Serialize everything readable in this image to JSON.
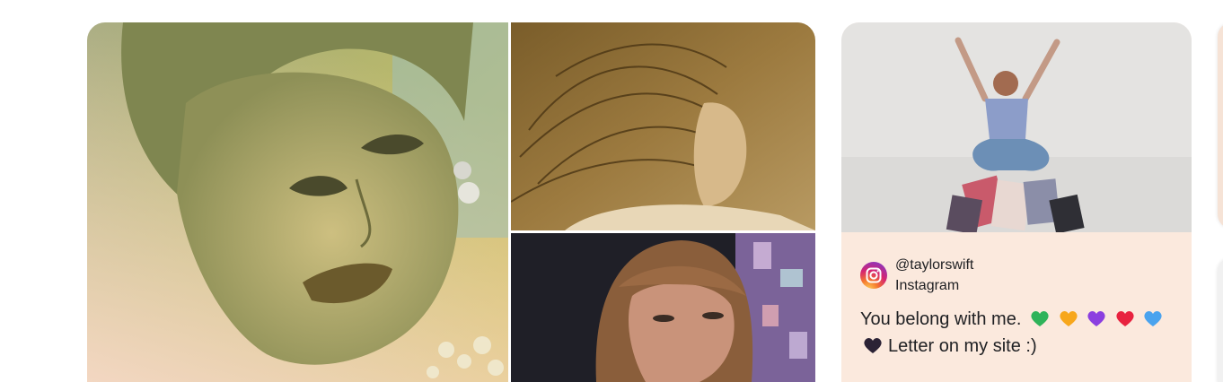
{
  "collage": {
    "main_photo_alt": "",
    "top_photo_alt": "",
    "bottom_photo_alt": ""
  },
  "instagram_card": {
    "handle": "@taylorswift",
    "platform": "Instagram",
    "caption_text": "You belong with me.",
    "caption_line2": "Letter on my site :)",
    "hearts": [
      "green-heart",
      "orange-heart",
      "purple-heart",
      "red-heart",
      "blue-heart"
    ],
    "hearts_line2": [
      "black-heart"
    ],
    "card_background": "#fbe9dd"
  },
  "colors": {
    "heart_green": "#2fb35a",
    "heart_orange": "#f7a71c",
    "heart_purple": "#8b3fe0",
    "heart_red": "#e8223f",
    "heart_blue": "#4aa3ee",
    "heart_black": "#2b2235"
  }
}
